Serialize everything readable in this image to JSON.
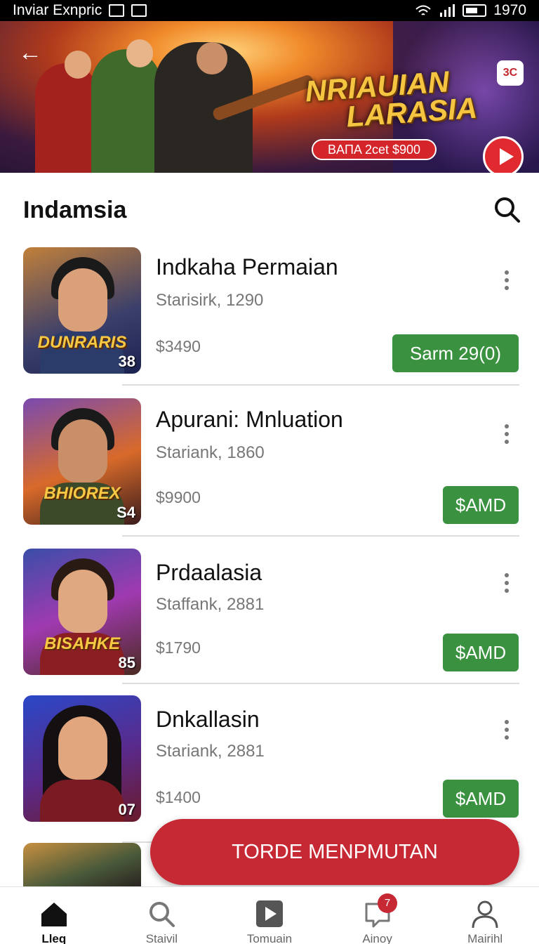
{
  "status_bar": {
    "carrier": "Inviar Exnpric",
    "time": "1970"
  },
  "banner": {
    "title_line1": "NRIAUIAN",
    "title_line2": "LARASIA",
    "subtitle": "BAПA 2cet $900",
    "corner_badge": "3C"
  },
  "header": {
    "title": "Indamsia"
  },
  "items": [
    {
      "title": "Indkaha Permaian",
      "subtitle": "Starisirk, 1290",
      "price": "$3490",
      "button": "Sarm 29(0)",
      "thumb_logo": "DUNRARIS",
      "thumb_num": "38"
    },
    {
      "title": "Apuranі: Mnluation",
      "subtitle": "Stariank, 1860",
      "price": "$9900",
      "button": "$AMD",
      "thumb_logo": "BHIOREX",
      "thumb_num": "S4"
    },
    {
      "title": "Prdaalasia",
      "subtitle": "Staffank, 2881",
      "price": "$1790",
      "button": "$AMD",
      "thumb_logo": "BISAHKE",
      "thumb_num": "85"
    },
    {
      "title": "Dnkallasin",
      "subtitle": "Stariank, 2881",
      "price": "$1400",
      "button": "$AMD",
      "thumb_logo": "",
      "thumb_num": "07"
    }
  ],
  "cta": {
    "label": "TORDE MENPMUTAN"
  },
  "nav": {
    "items": [
      {
        "label": "Lleq"
      },
      {
        "label": "Staivil"
      },
      {
        "label": "Tomuain"
      },
      {
        "label": "Ainoy"
      },
      {
        "label": "Mairihl"
      }
    ],
    "badge": "7"
  },
  "colors": {
    "accent_red": "#c62834",
    "buy_green": "#3a9240"
  }
}
